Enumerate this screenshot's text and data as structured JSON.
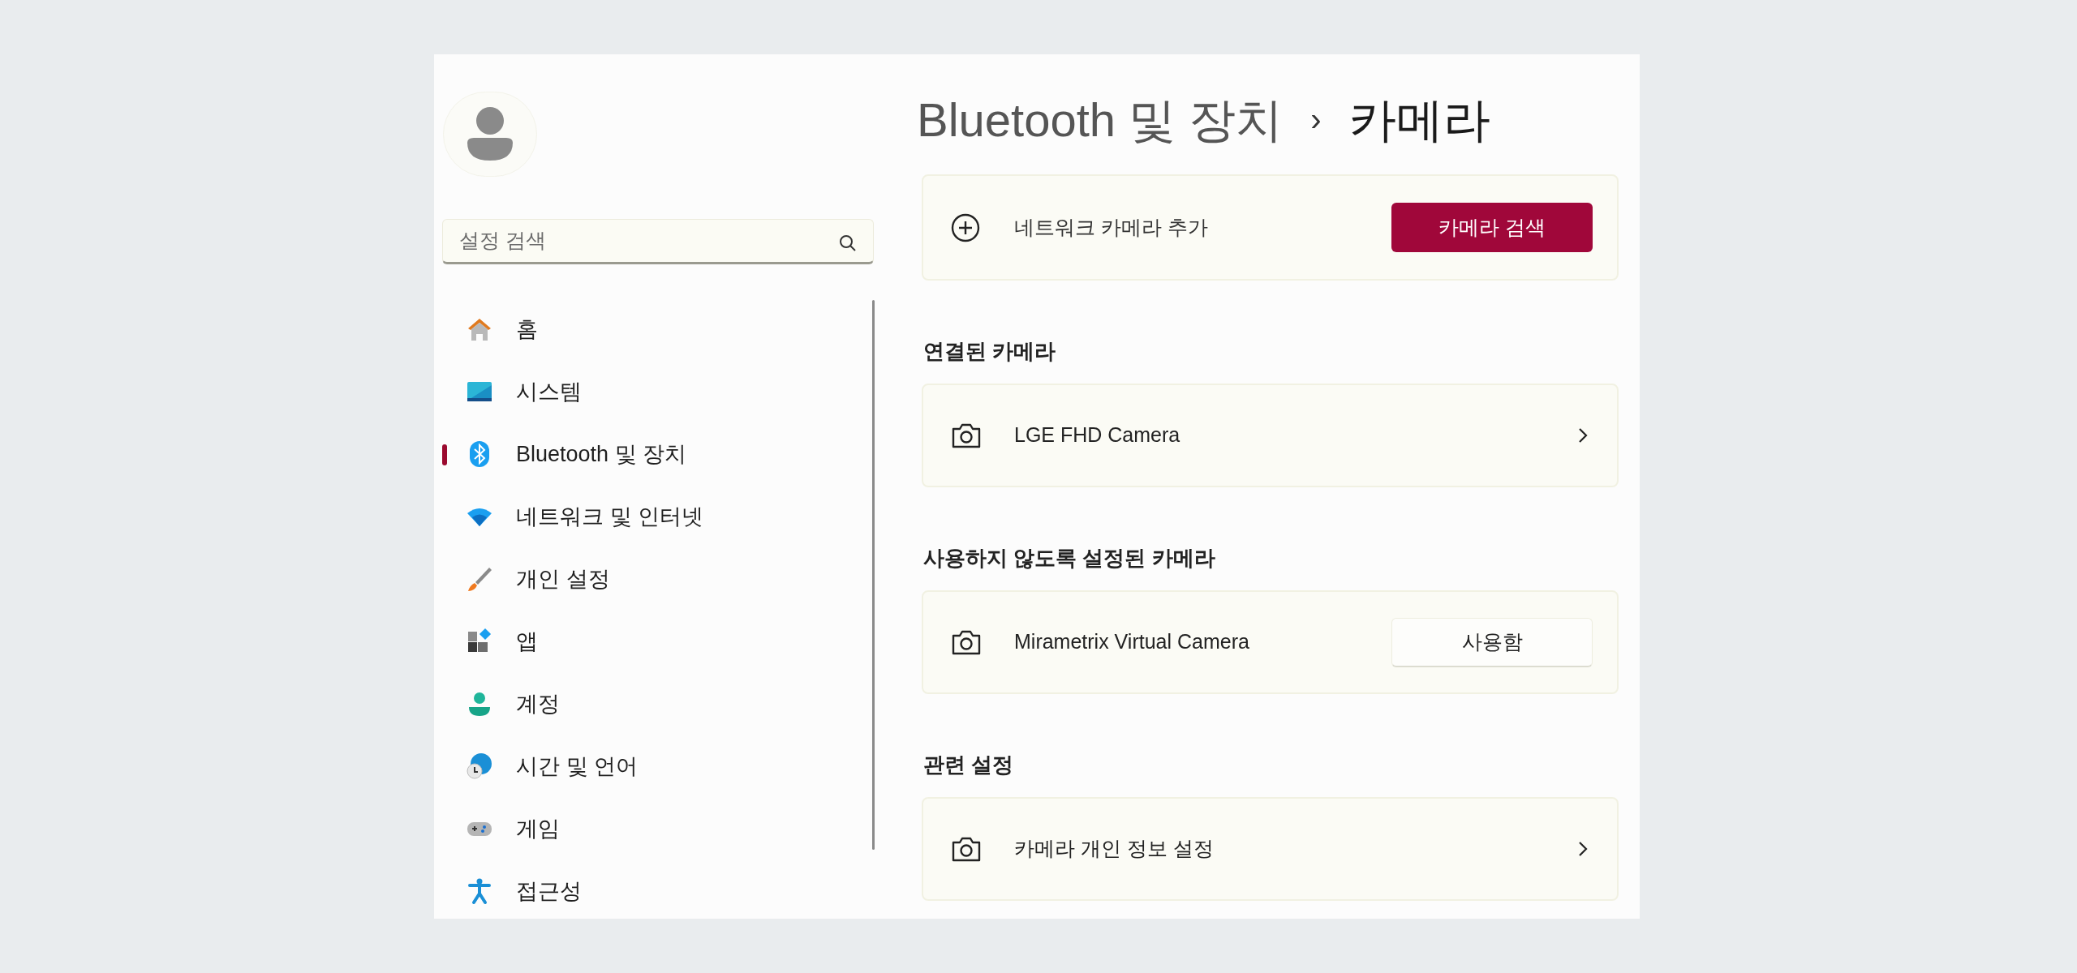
{
  "sidebar": {
    "search": {
      "placeholder": "설정 검색"
    },
    "items": [
      {
        "label": "홈",
        "selected": false
      },
      {
        "label": "시스템",
        "selected": false
      },
      {
        "label": "Bluetooth 및 장치",
        "selected": true
      },
      {
        "label": "네트워크 및 인터넷",
        "selected": false
      },
      {
        "label": "개인 설정",
        "selected": false
      },
      {
        "label": "앱",
        "selected": false
      },
      {
        "label": "계정",
        "selected": false
      },
      {
        "label": "시간 및 언어",
        "selected": false
      },
      {
        "label": "게임",
        "selected": false
      },
      {
        "label": "접근성",
        "selected": false
      }
    ]
  },
  "breadcrumb": {
    "parent": "Bluetooth 및 장치",
    "separator": "›",
    "current": "카메라"
  },
  "add_card": {
    "label": "네트워크 카메라 추가",
    "button": "카메라 검색"
  },
  "sections": [
    {
      "heading": "연결된 카메라",
      "rows": [
        {
          "kind": "link",
          "label": "LGE FHD Camera"
        }
      ]
    },
    {
      "heading": "사용하지 않도록 설정된 카메라",
      "rows": [
        {
          "kind": "button",
          "label": "Mirametrix Virtual Camera",
          "button": "사용함"
        }
      ]
    },
    {
      "heading": "관련 설정",
      "rows": [
        {
          "kind": "link",
          "label": "카메라 개인 정보 설정"
        }
      ]
    }
  ]
}
